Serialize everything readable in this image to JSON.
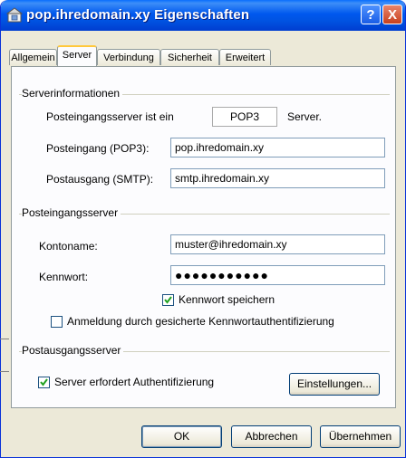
{
  "window": {
    "title": "pop.ihredomain.xy Eigenschaften"
  },
  "titlebar_buttons": {
    "help": "?",
    "close": "X"
  },
  "tabs": [
    {
      "label": "Allgemein"
    },
    {
      "label": "Server"
    },
    {
      "label": "Verbindung"
    },
    {
      "label": "Sicherheit"
    },
    {
      "label": "Erweitert"
    }
  ],
  "active_tab": "Server",
  "serverinfo": {
    "group_label": "Serverinformationen",
    "incoming_type_prefix": "Posteingangsserver ist ein",
    "incoming_type_value": "POP3",
    "incoming_type_suffix": "Server.",
    "incoming_label": "Posteingang (POP3):",
    "incoming_value": "pop.ihredomain.xy",
    "outgoing_label": "Postausgang (SMTP):",
    "outgoing_value": "smtp.ihredomain.xy"
  },
  "incoming_server": {
    "group_label": "Posteingangsserver",
    "account_label": "Kontoname:",
    "account_value": "muster@ihredomain.xy",
    "password_label": "Kennwort:",
    "password_value": "●●●●●●●●●●●",
    "remember_password_label": "Kennwort speichern",
    "remember_password_checked": true,
    "spa_label": "Anmeldung durch gesicherte Kennwortauthentifizierung",
    "spa_checked": false
  },
  "outgoing_server": {
    "group_label": "Postausgangsserver",
    "auth_label": "Server erfordert Authentifizierung",
    "auth_checked": true,
    "settings_button": "Einstellungen..."
  },
  "footer": {
    "ok": "OK",
    "cancel": "Abbrechen",
    "apply": "Übernehmen"
  }
}
